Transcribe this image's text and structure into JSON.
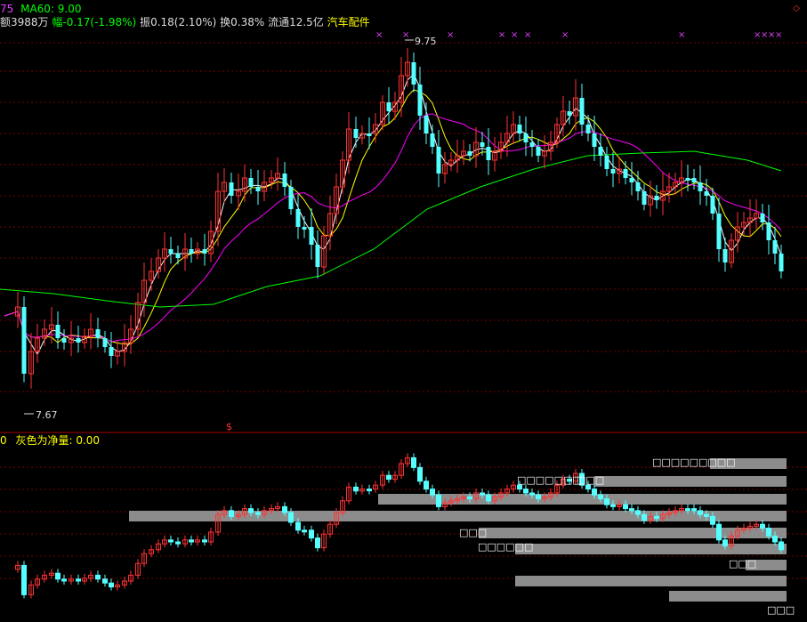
{
  "header": {
    "row1_prefix": "75",
    "ma60_label": "MA60: 9.00",
    "amount": "额3988万",
    "change": "幅-0.17(-1.98%)",
    "amplitude": "振0.18(2.10%)",
    "turnover": "换0.38%",
    "float_cap": "流通12.5亿",
    "sector": "汽车配件"
  },
  "main_chart": {
    "high_label": "9.75",
    "low_label": "7.67",
    "cross_marker": "×",
    "divider_marker": "$"
  },
  "sub_chart": {
    "prefix": "0",
    "title": "灰色为净量: 0.00"
  },
  "volume_profile_labels": [
    "□□□□□□□□□",
    "□□□□□□□",
    "□□□",
    "□□□",
    "□□□□□□",
    "□□□",
    "□□□"
  ],
  "colors": {
    "up": "#ff3333",
    "down": "#54ffff",
    "ma5": "#ffffff",
    "ma10": "#ffff00",
    "ma20": "#ff00ff",
    "ma60": "#00ff00",
    "grid": "#7a0000",
    "profile": "#8c8c8c"
  },
  "corner_icon": "diamond-icon"
}
